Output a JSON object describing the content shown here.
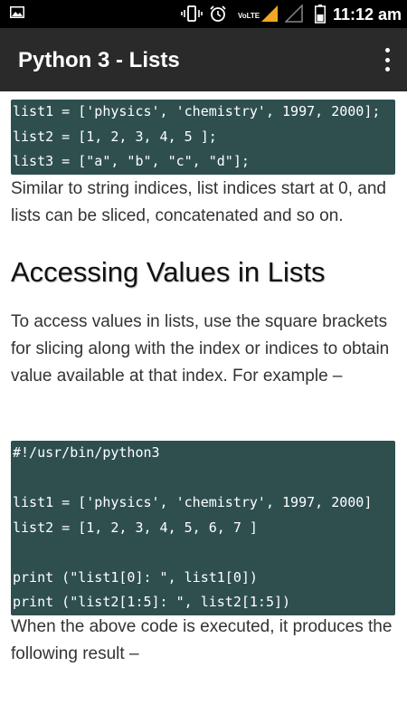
{
  "status_bar": {
    "time": "11:12 am",
    "network_label": "VoLTE",
    "icons": [
      "gallery-icon",
      "vibrate-icon",
      "alarm-icon",
      "signal-icon",
      "signal-empty-icon",
      "battery-icon"
    ]
  },
  "app_bar": {
    "title": "Python 3 - Lists",
    "menu_icon": "overflow-menu-icon"
  },
  "content": {
    "code_block_1": [
      "list1 = ['physics', 'chemistry', 1997, 2000];",
      "list2 = [1, 2, 3, 4, 5 ];",
      "list3 = [\"a\", \"b\", \"c\", \"d\"];"
    ],
    "paragraph_1": "Similar to string indices, list indices start at 0, and lists can be sliced, concatenated and so on.",
    "heading": "Accessing Values in Lists",
    "paragraph_2": "To access values in lists, use the square brackets for slicing along with the index or indices to obtain value available at that index. For example –",
    "code_block_2": [
      "#!/usr/bin/python3",
      "",
      "list1 = ['physics', 'chemistry', 1997, 2000]",
      "list2 = [1, 2, 3, 4, 5, 6, 7 ]",
      "",
      "print (\"list1[0]: \", list1[0])",
      "print (\"list2[1:5]: \", list2[1:5])"
    ],
    "paragraph_3": "When the above code is executed, it produces the following result –"
  },
  "colors": {
    "status_bar": "#000000",
    "app_bar": "#2a2a2a",
    "code_background": "#2f4f4f",
    "signal_accent": "#f5a623"
  }
}
